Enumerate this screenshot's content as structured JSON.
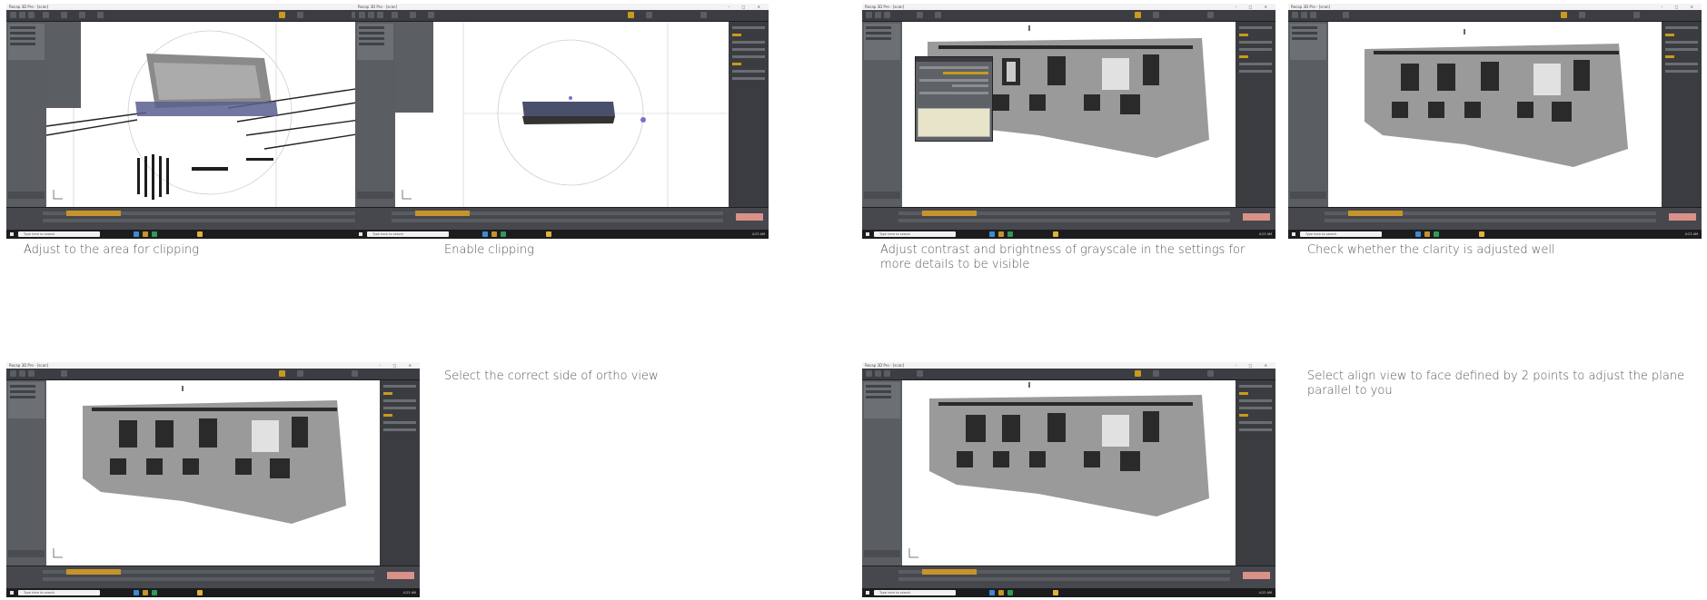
{
  "app": {
    "window_title": "Recap 3D Pro - [scan]",
    "taskbar_search": "Type here to search",
    "clock": "4:23 AM"
  },
  "steps": [
    {
      "caption": "Adjust to the area for clipping"
    },
    {
      "caption": "Enable clipping"
    },
    {
      "caption": "Adjust contrast and brightness of grayscale in the settings for more details to be visible"
    },
    {
      "caption": "Check whether the clarity is adjusted well"
    },
    {
      "caption": "Select the correct side of ortho view"
    },
    {
      "caption": "Select align view to face defined by 2 points to adjust the plane parallel to you"
    }
  ],
  "colors": {
    "ui_dark": "#2b2d31",
    "panel_gray": "#5a5d62",
    "accent_orange": "#c99a1f",
    "clip_box_blue": "#5a5f8f",
    "gizmo_purple": "#7b6fd0"
  }
}
